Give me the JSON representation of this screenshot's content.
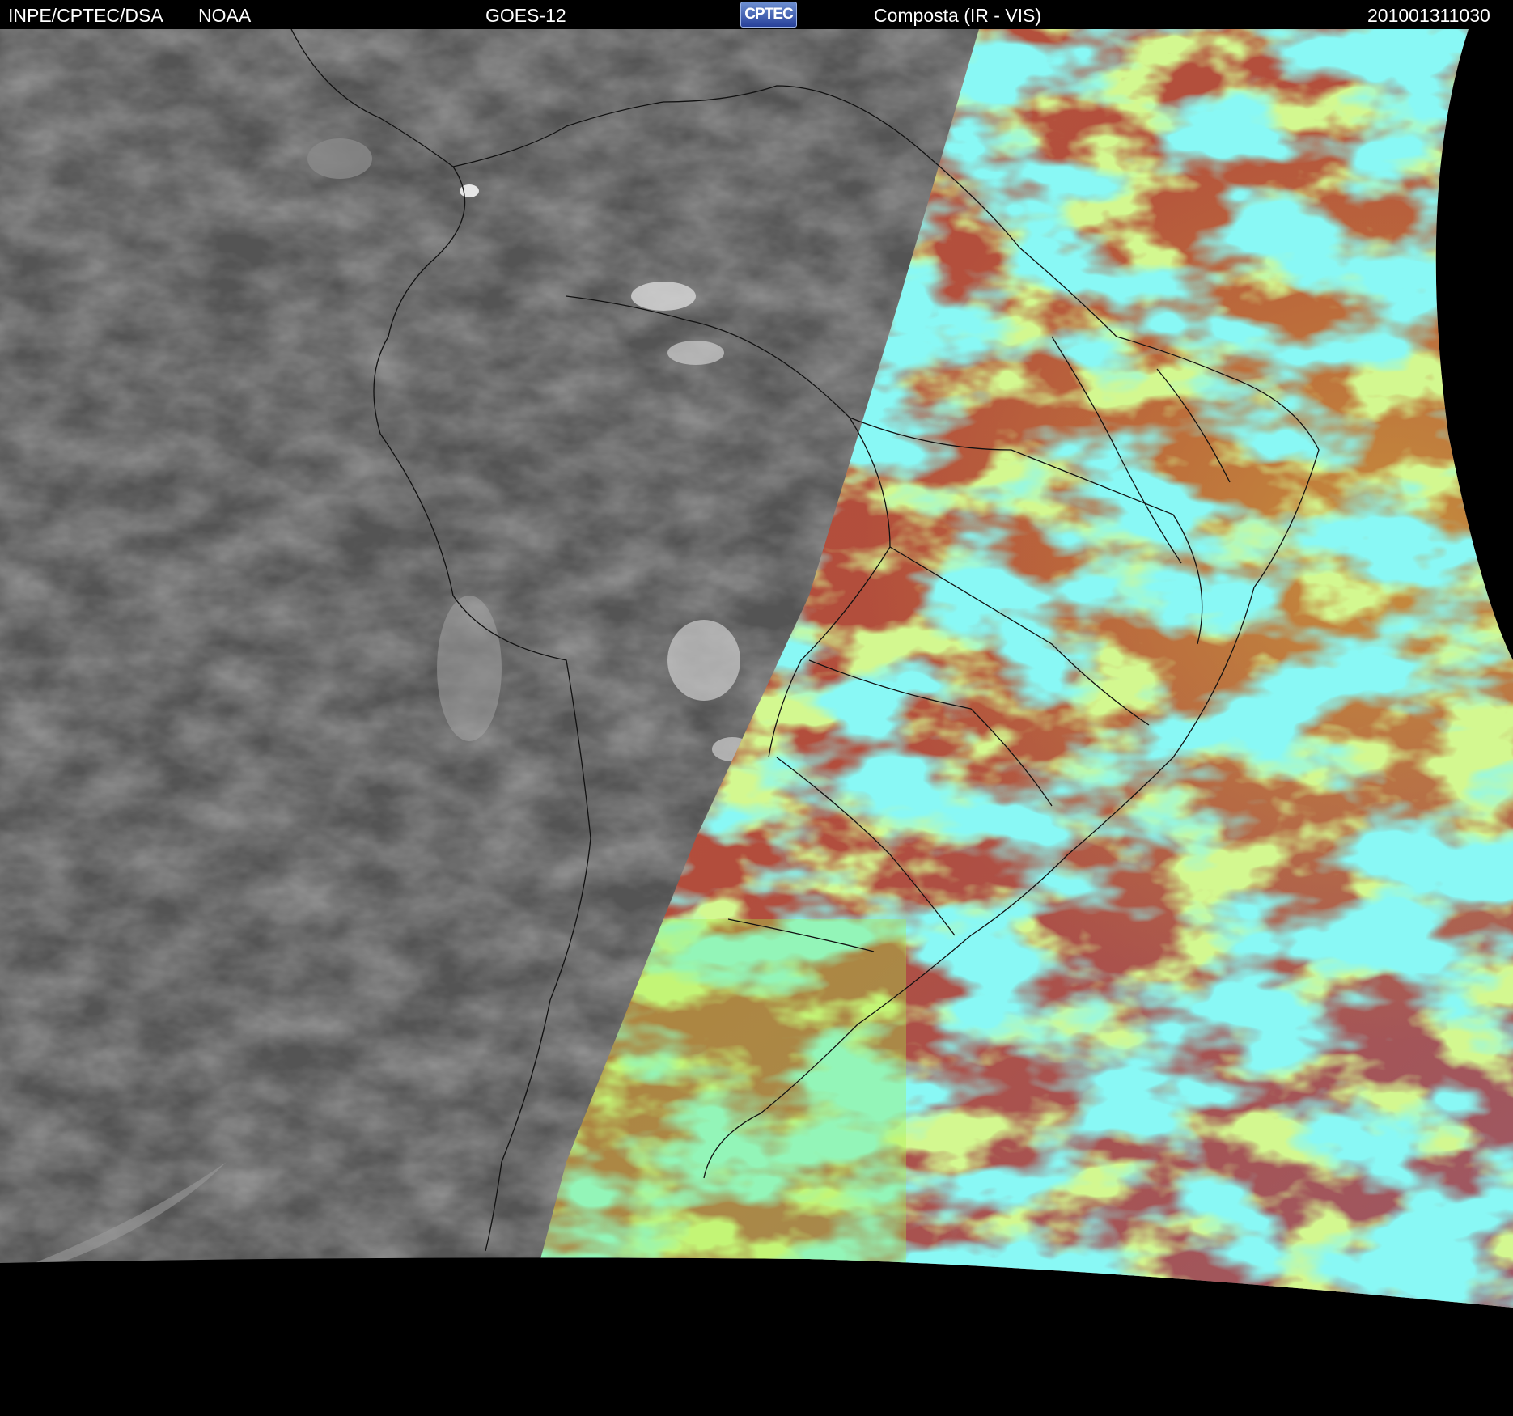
{
  "header": {
    "source": "INPE/CPTEC/DSA",
    "agency": "NOAA",
    "satellite": "GOES-12",
    "logo": "CPTEC",
    "product": "Composta (IR - VIS)",
    "timestamp": "201001311030"
  },
  "colors": {
    "background": "#000000",
    "ir_gray": "#5a5a5a",
    "vis_red": "#b6553c",
    "vis_cyan": "#3ff0e8",
    "vis_green": "#a6f047",
    "vis_orange": "#c88a3a",
    "coastline": "#111111"
  },
  "icons": {
    "logo": "cptec-logo"
  }
}
